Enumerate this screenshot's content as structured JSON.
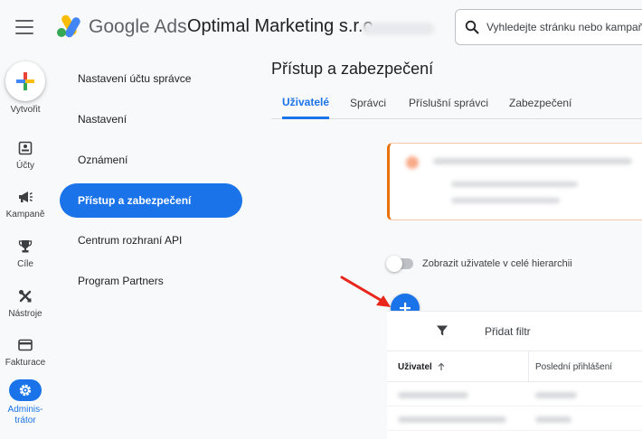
{
  "header": {
    "brand_google": "Google",
    "brand_ads": "Ads",
    "account_name": "Optimal Marketing s.r.o.",
    "search_placeholder": "Vyhledejte stránku nebo kampaň"
  },
  "rail": {
    "create_label": "Vytvořit",
    "items": [
      {
        "label": "Účty",
        "icon": "accounts-icon"
      },
      {
        "label": "Kampaně",
        "icon": "megaphone-icon"
      },
      {
        "label": "Cíle",
        "icon": "trophy-icon"
      },
      {
        "label": "Nástroje",
        "icon": "tools-icon"
      },
      {
        "label": "Fakturace",
        "icon": "credit-card-icon"
      },
      {
        "label": "Adminis-\ntrátor",
        "icon": "gear-icon",
        "active": true
      }
    ]
  },
  "nav": {
    "items": [
      {
        "label": "Nastavení účtu správce"
      },
      {
        "label": "Nastavení"
      },
      {
        "label": "Oznámení"
      },
      {
        "label": "Přístup a zabezpečení",
        "active": true
      },
      {
        "label": "Centrum rozhraní API"
      },
      {
        "label": "Program Partners"
      }
    ]
  },
  "main": {
    "title": "Přístup a zabezpečení",
    "tabs": [
      {
        "label": "Uživatelé",
        "active": true
      },
      {
        "label": "Správci"
      },
      {
        "label": "Příslušní správci"
      },
      {
        "label": "Zabezpečení"
      }
    ],
    "toggle_label": "Zobrazit uživatele v celé hierarchii",
    "toggle_on": false,
    "filter_label": "Přidat filtr",
    "columns": {
      "user": "Uživatel",
      "last_login": "Poslední přihlášení"
    }
  },
  "colors": {
    "accent": "#1a73e8",
    "warning_border": "#e8710a",
    "annotation_arrow": "#e8261c"
  }
}
